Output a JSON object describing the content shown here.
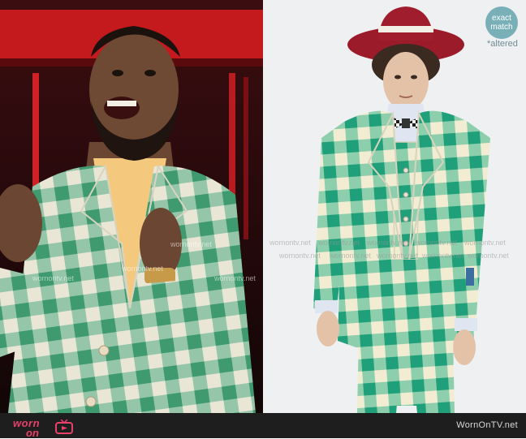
{
  "badge": {
    "line1": "exact",
    "line2": "match",
    "altered": "*altered"
  },
  "watermarks": {
    "text": "wornontv.net",
    "text_alt": "wornontv.net"
  },
  "footer": {
    "logo_part1": "worn",
    "logo_part2": "on",
    "site_name": "WornOnTV.net"
  },
  "colors": {
    "accent_pink": "#e9416a",
    "check_green": "#2aa17a",
    "check_cream": "#f1ecd2",
    "hat_red": "#9b1b2a",
    "badge_teal": "#79b0b8"
  }
}
